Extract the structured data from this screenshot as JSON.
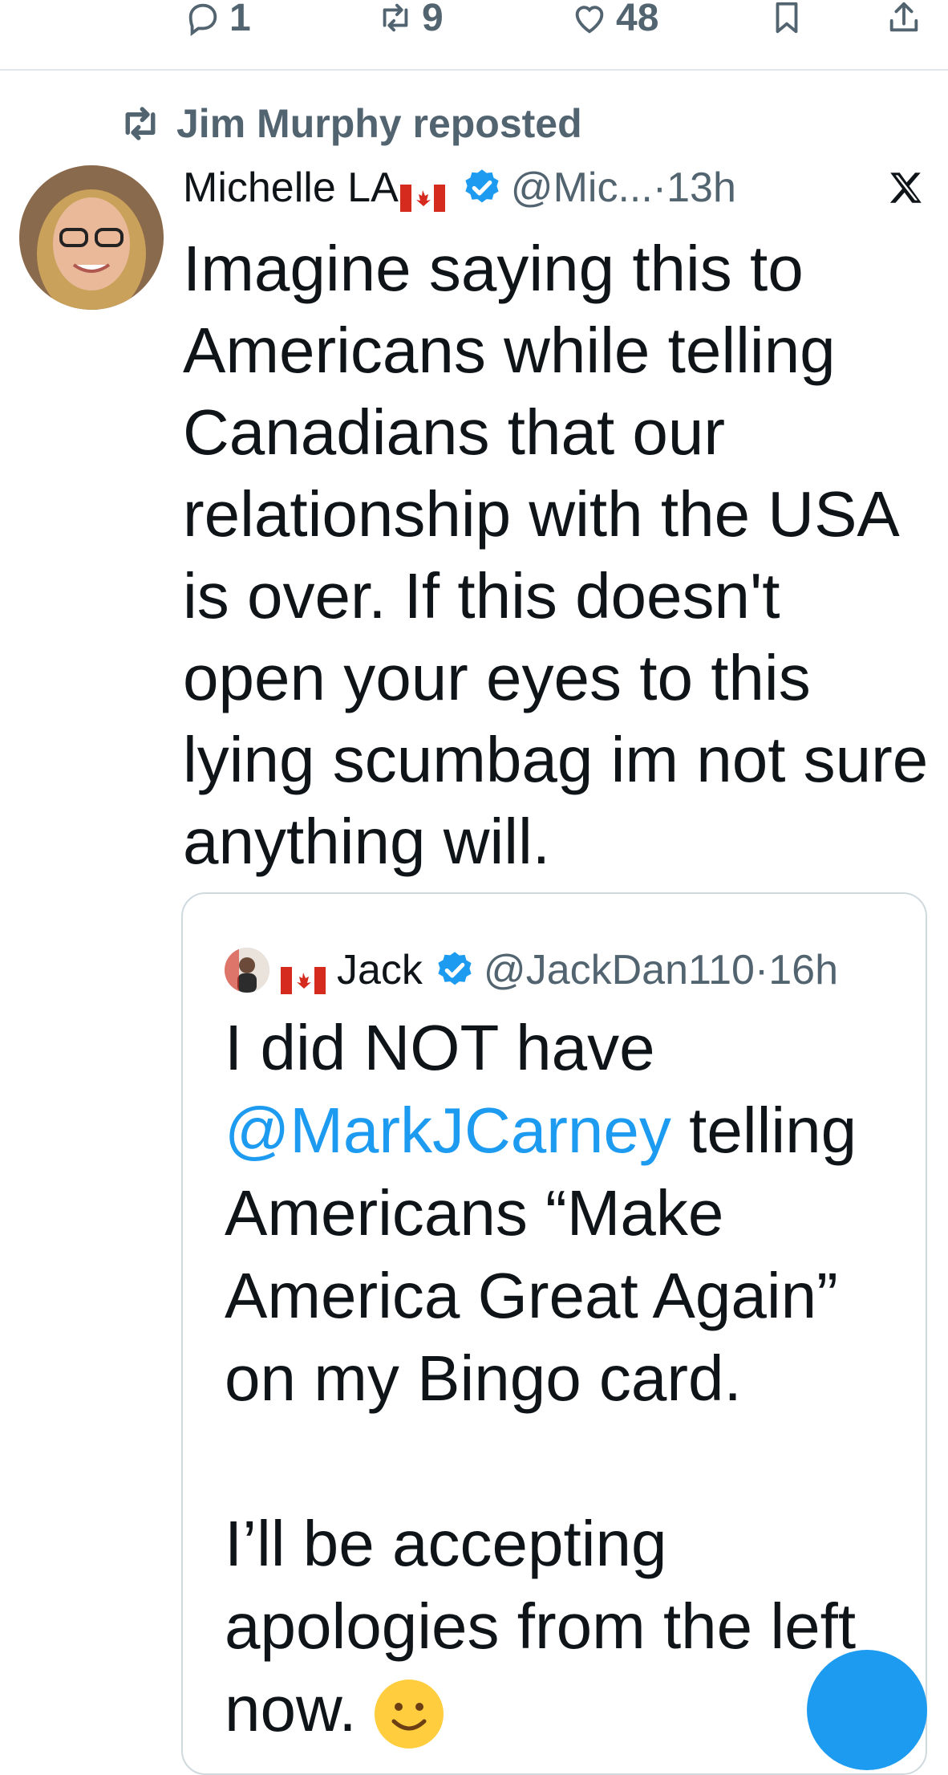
{
  "actions": {
    "reply_count": "1",
    "repost_count": "9",
    "like_count": "48"
  },
  "repost_line": "Jim Murphy reposted",
  "tweet": {
    "author": "Michelle LA",
    "flag_icon": "canada-flag-icon",
    "handle": "@Mic...",
    "time": "13h",
    "text": "Imagine saying this to Americans while telling Canadians that our relationship with the USA is over. If this doesn't open your eyes to this lying scumbag im not sure anything will."
  },
  "quote": {
    "author": "Jack",
    "handle": "@JackDan110",
    "time": "16h",
    "text_line1": "I did NOT have",
    "mention": "@MarkJCarney",
    "text_after_mention": " telling Americans “Make America Great Again” on my Bingo card.",
    "text_para2": "I’ll be accepting apologies from the left now."
  },
  "colors": {
    "accent": "#1d9bf0",
    "muted": "#536471",
    "text": "#0f1419",
    "border": "#cfd9de"
  }
}
